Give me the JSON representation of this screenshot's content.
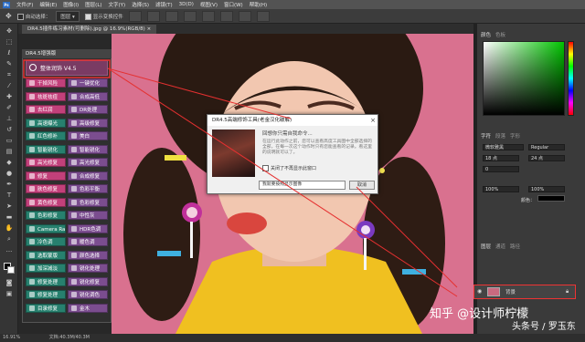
{
  "menubar": {
    "app_icon": "Ps",
    "items": [
      "文件(F)",
      "编辑(E)",
      "图像(I)",
      "图层(L)",
      "文字(Y)",
      "选择(S)",
      "滤镜(T)",
      "3D(D)",
      "视图(V)",
      "窗口(W)",
      "帮助(H)"
    ]
  },
  "options": {
    "auto_select_label": "自动选择：",
    "layer_select": "图层",
    "show_transform_label": "显示变换控件"
  },
  "document": {
    "tab_label": "DR4.5插件练习素材(可删除).jpg @ 16.9%(RGB/8)"
  },
  "plugin_panel": {
    "title": "DR4.5增强版",
    "banner": "整体润饰 V4.5",
    "buttons": [
      {
        "label": "干掉风险",
        "color": "#c2407a"
      },
      {
        "label": "一键优化",
        "color": "#7b4d8f"
      },
      {
        "label": "祛斑祛痘",
        "color": "#c2407a"
      },
      {
        "label": "合成高低",
        "color": "#7b4d8f"
      },
      {
        "label": "去红润",
        "color": "#c2407a"
      },
      {
        "label": "DR处理",
        "color": "#7b4d8f"
      },
      {
        "label": "高速曝光",
        "color": "#27806e"
      },
      {
        "label": "高级修复",
        "color": "#7b4d8f"
      },
      {
        "label": "红色修补",
        "color": "#27806e"
      },
      {
        "label": "美白",
        "color": "#7b4d8f"
      },
      {
        "label": "智能锐化",
        "color": "#27806e"
      },
      {
        "label": "智能锐化",
        "color": "#7b4d8f"
      },
      {
        "label": "高光修复",
        "color": "#c2407a"
      },
      {
        "label": "高光修复",
        "color": "#7b4d8f"
      },
      {
        "label": "修复",
        "color": "#c2407a"
      },
      {
        "label": "合成修复",
        "color": "#7b4d8f"
      },
      {
        "label": "肤色修复",
        "color": "#c2407a"
      },
      {
        "label": "色彩平衡",
        "color": "#7b4d8f"
      },
      {
        "label": "黄色修复",
        "color": "#c2407a"
      },
      {
        "label": "色彩修复",
        "color": "#7b4d8f"
      },
      {
        "label": "色彩修复",
        "color": "#27806e"
      },
      {
        "label": "中性灰",
        "color": "#7b4d8f"
      },
      {
        "label": "Camera Raw",
        "color": "#27806e"
      },
      {
        "label": "HDR色调",
        "color": "#7b4d8f"
      },
      {
        "label": "冷色调",
        "color": "#27806e"
      },
      {
        "label": "暖色调",
        "color": "#7b4d8f"
      },
      {
        "label": "选取蒙版",
        "color": "#27806e"
      },
      {
        "label": "颜色选择",
        "color": "#7b4d8f"
      },
      {
        "label": "加深减淡",
        "color": "#27806e"
      },
      {
        "label": "锐化处理",
        "color": "#7b4d8f"
      },
      {
        "label": "修复处理",
        "color": "#27806e"
      },
      {
        "label": "锐化修复",
        "color": "#7b4d8f"
      },
      {
        "label": "修复处理",
        "color": "#27806e"
      },
      {
        "label": "锐化调色",
        "color": "#7b4d8f"
      },
      {
        "label": "目录修复",
        "color": "#27806e"
      },
      {
        "label": "金木",
        "color": "#7b4d8f"
      }
    ]
  },
  "dialog": {
    "title": "DR4.5高端修饰工具(老金汉化破解)",
    "heading": "回想你只需自我命令...",
    "body": "在运行此动作之前，您可以查看高度工具图中全部选择的全部，在每一次这个动作时只有您能查看的记录。看这里的说明就可以了。",
    "checkbox_label": "关闭了不再显示此窗口",
    "input_value": "我就要按照显示图像",
    "cancel_label": "取消"
  },
  "right_panel": {
    "color_tab": "颜色",
    "swatch_tab": "色板",
    "char_tabs": [
      "字符",
      "段落",
      "字形"
    ],
    "font_family": "微软雅黑",
    "font_style": "Regular",
    "font_size": "18 点",
    "leading": "24 点",
    "tracking": "0",
    "scale_v": "100%",
    "scale_h": "100%",
    "color_label": "颜色：",
    "layers_tabs": [
      "图层",
      "通道",
      "路径"
    ],
    "layer_name": "背景"
  },
  "status": {
    "zoom": "16.91%",
    "doc_info": "文档:40.3M/40.3M"
  },
  "watermark": {
    "line1": "知乎 @设计师柠檬",
    "line2": "头条号 / 罗玉东"
  },
  "colors": {
    "canvas_bg": "#d9718f",
    "annotation_red": "#e53030",
    "hair": "#2a1a12",
    "skin": "#f2c7b0",
    "sweater": "#f0c020"
  }
}
